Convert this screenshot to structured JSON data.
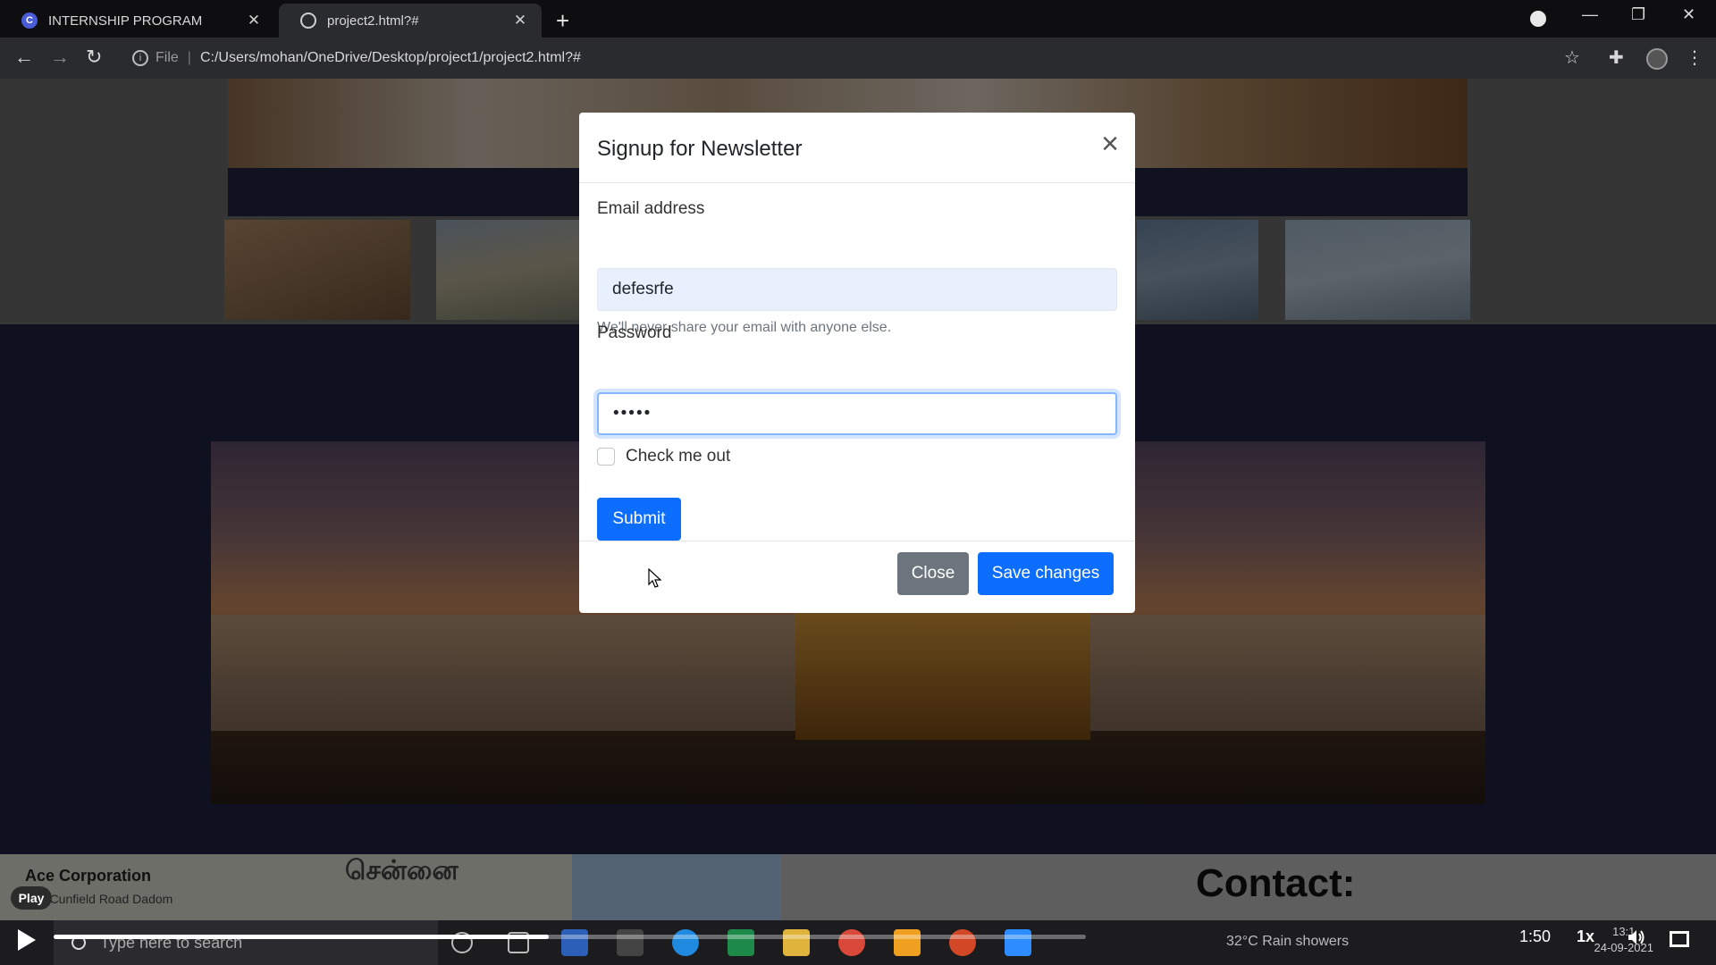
{
  "browser": {
    "tabs": [
      {
        "title": "INTERNSHIP PROGRAM",
        "icon": "c-logo-icon"
      },
      {
        "title": "project2.html?#",
        "icon": "globe-icon"
      }
    ],
    "new_tab_symbol": "+",
    "address": {
      "scheme": "File",
      "url": "C:/Users/mohan/OneDrive/Desktop/project1/project2.html?#"
    }
  },
  "page": {
    "footer": {
      "map_title": "Ace Corporation",
      "map_subtitle": "4/ Cunfield Road Dadom",
      "map_tamil": "சென்னை",
      "contact_heading": "Contact:"
    }
  },
  "modal": {
    "title": "Signup for Newsletter",
    "close_symbol": "×",
    "email": {
      "label": "Email address",
      "value": "defesrfe",
      "help": "We'll never share your email with anyone else."
    },
    "password": {
      "label": "Password",
      "value": "•••••"
    },
    "checkbox": {
      "label": "Check me out",
      "checked": false
    },
    "submit_label": "Submit",
    "footer": {
      "close_label": "Close",
      "save_label": "Save changes"
    }
  },
  "taskbar": {
    "search_placeholder": "Type here to search",
    "weather": "32°C  Rain showers",
    "clock_time": "13:1",
    "clock_date": "24-09-2021"
  },
  "video": {
    "play_badge": "Play",
    "time": "1:50",
    "speed": "1x",
    "progress_fraction": 0.48
  },
  "colors": {
    "primary": "#0d6efd",
    "secondary": "#6c757d",
    "page_navy": "#1f2040"
  }
}
